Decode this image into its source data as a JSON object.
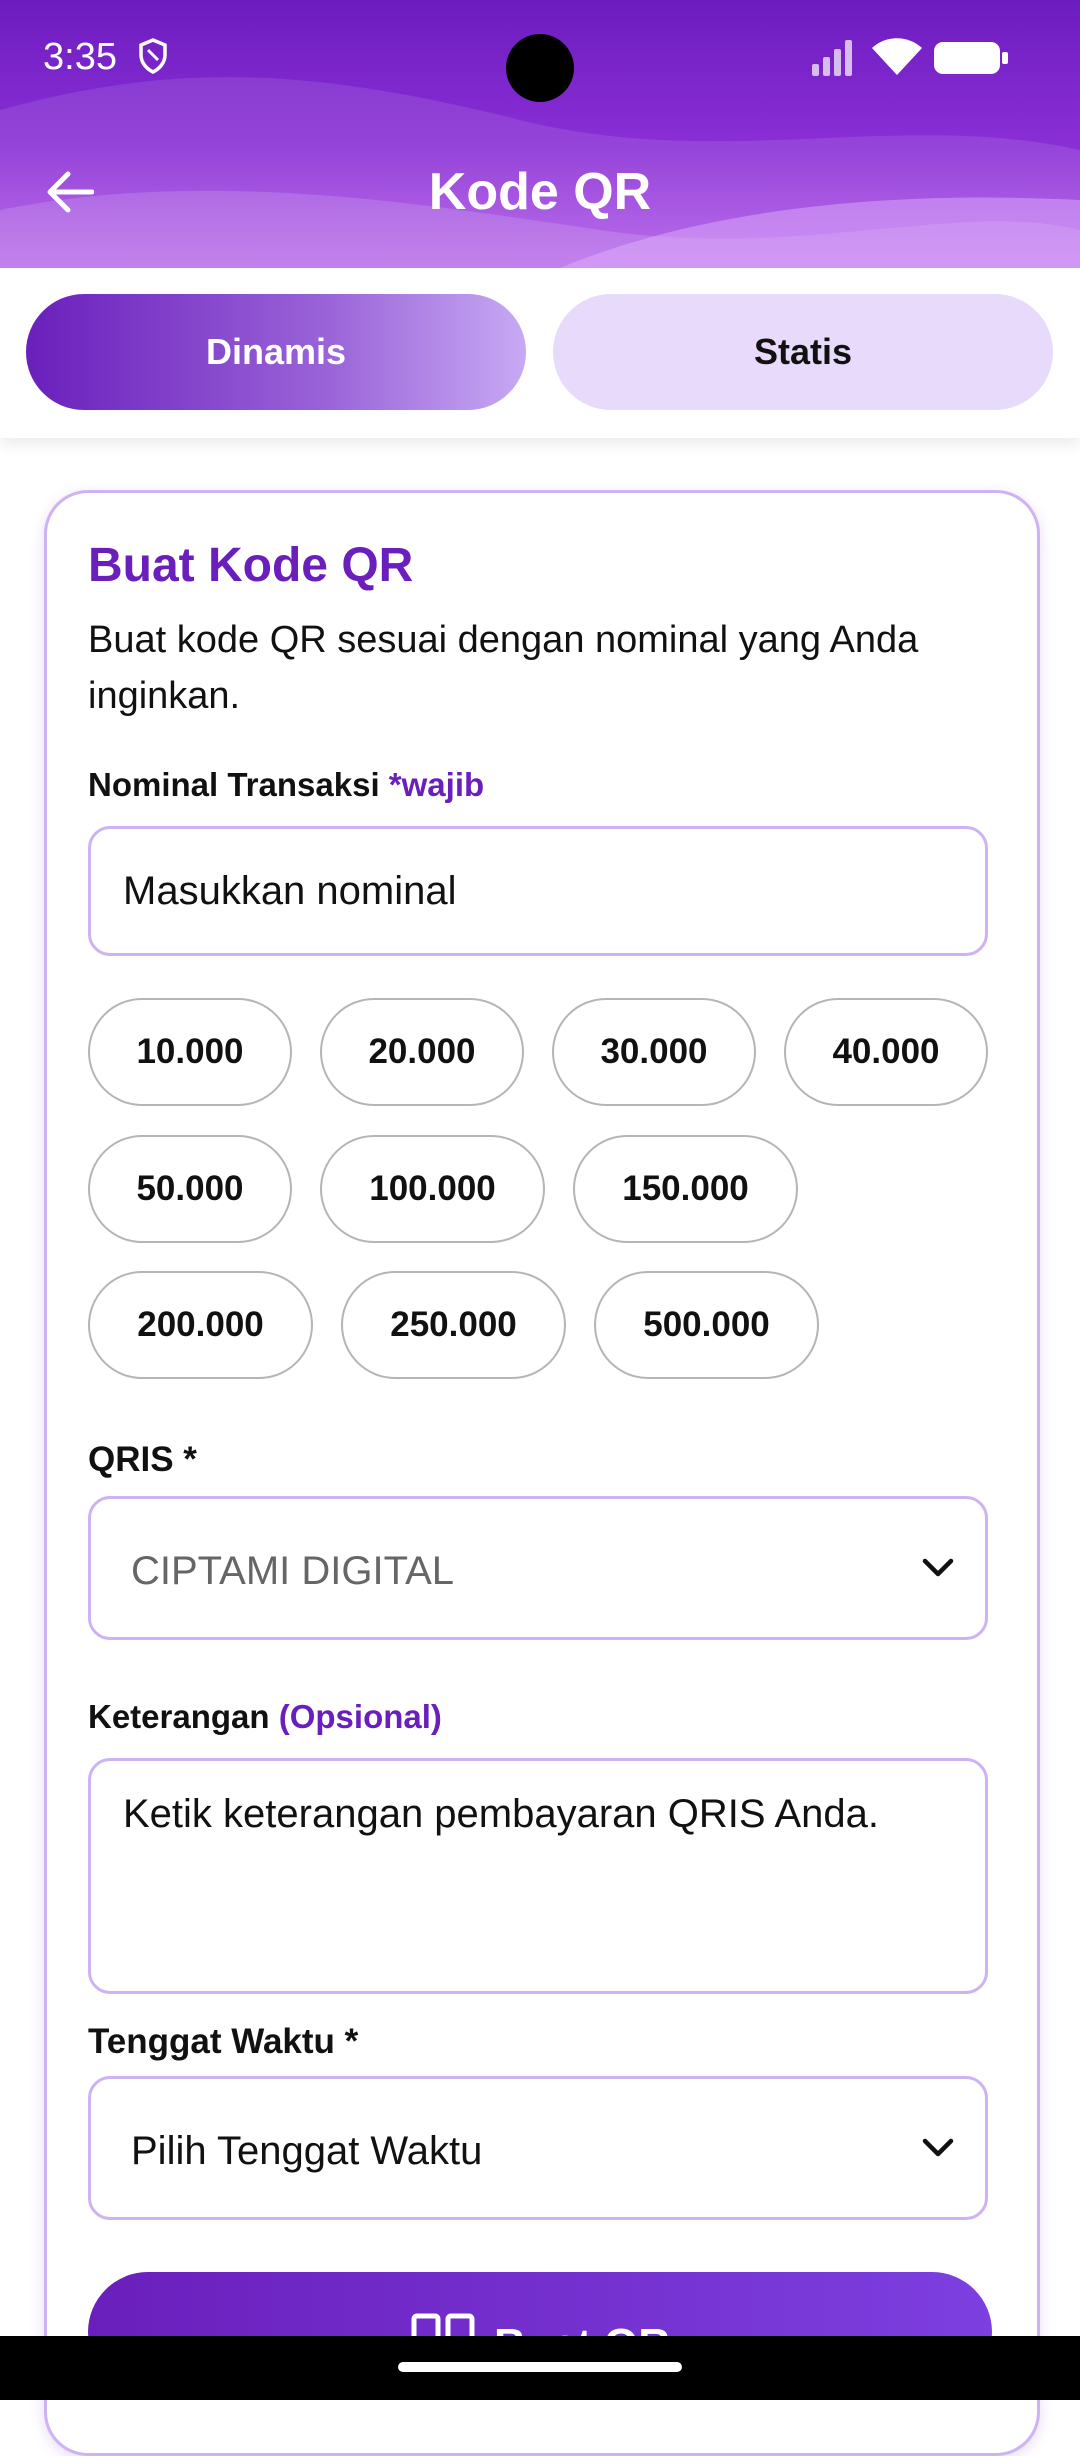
{
  "status_bar": {
    "time": "3:35"
  },
  "header": {
    "title": "Kode QR"
  },
  "tabs": [
    {
      "label": "Dinamis",
      "active": true
    },
    {
      "label": "Statis",
      "active": false
    }
  ],
  "card": {
    "title": "Buat Kode QR",
    "description": "Buat kode QR sesuai dengan nominal yang Anda inginkan.",
    "nominal": {
      "label": "Nominal Transaksi",
      "required_tag": "*wajib",
      "placeholder": "Masukkan nominal"
    },
    "amount_chips": [
      "10.000",
      "20.000",
      "30.000",
      "40.000",
      "50.000",
      "100.000",
      "150.000",
      "200.000",
      "250.000",
      "500.000"
    ],
    "qris": {
      "label": "QRIS *",
      "value": "CIPTAMI DIGITAL"
    },
    "keterangan": {
      "label": "Keterangan",
      "optional_tag": "(Opsional)",
      "placeholder": "Ketik keterangan pembayaran QRIS Anda."
    },
    "tenggat": {
      "label": "Tenggat Waktu *",
      "value": "Pilih Tenggat Waktu"
    },
    "submit_label": "Buat QR"
  },
  "colors": {
    "primary": "#6a1fbc",
    "border": "#cdb3f3",
    "tab_inactive_bg": "#e7dafb"
  }
}
